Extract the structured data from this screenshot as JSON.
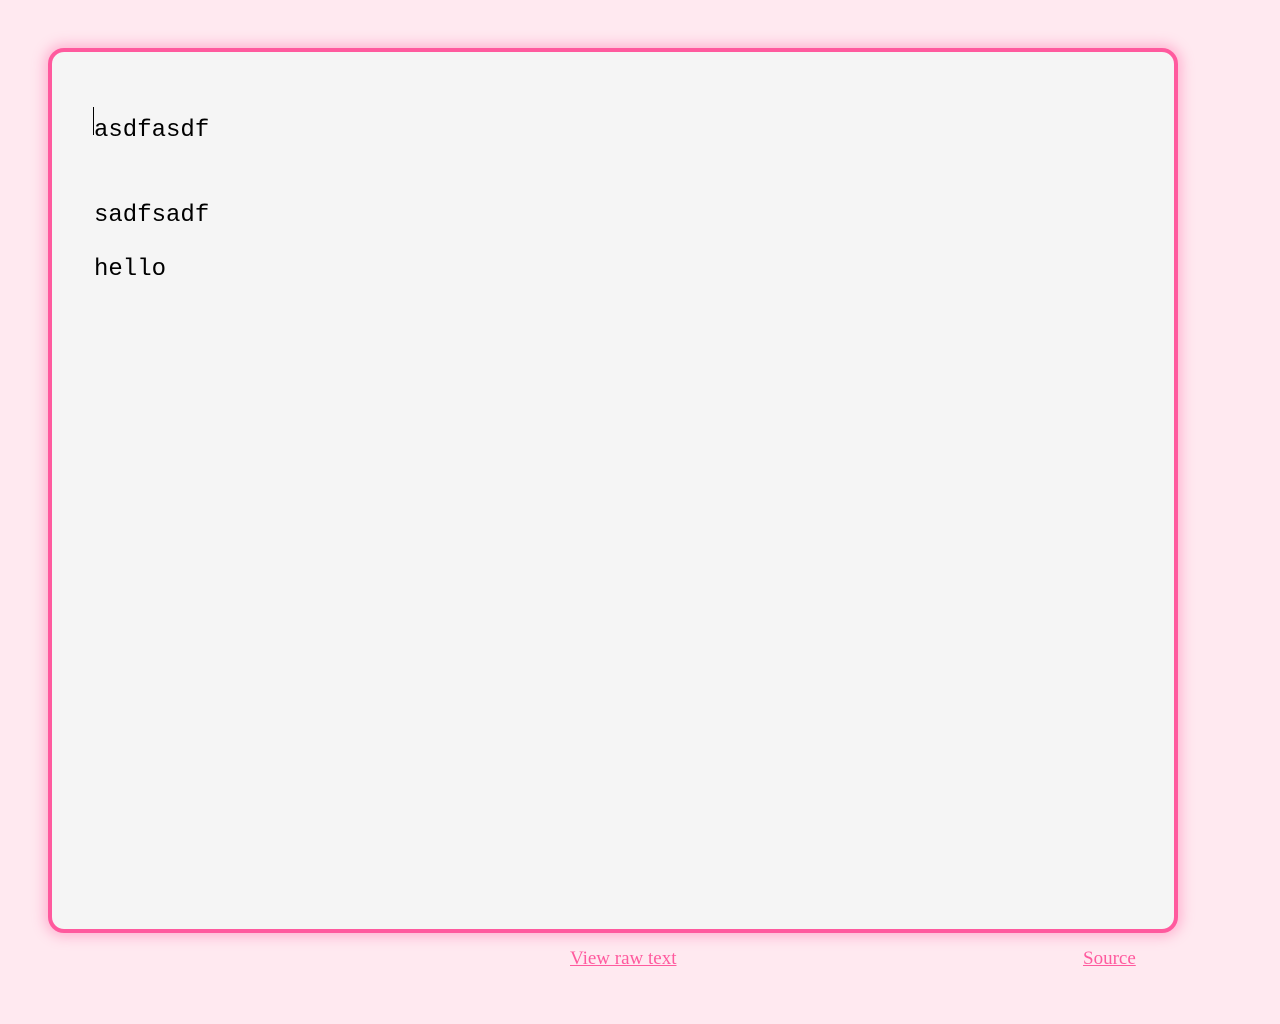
{
  "content": {
    "line1": "asdfasdf",
    "line2": "sadfsadf",
    "line3": "hello"
  },
  "footer": {
    "view_raw": "View raw text",
    "source": "Source"
  },
  "colors": {
    "bg": "#ffe9f0",
    "panel_bg": "#f5f5f5",
    "accent": "#ff5a9e"
  }
}
